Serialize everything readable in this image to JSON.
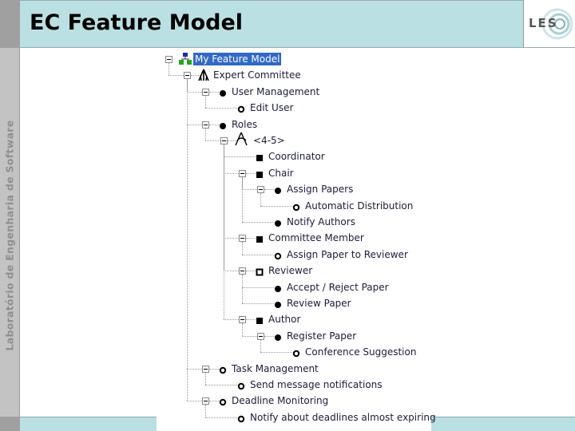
{
  "slide": {
    "title": "EC Feature Model",
    "sidebar_text": "Laboratório de Engenharia de Software",
    "logo_text": "LES",
    "colors": {
      "header": "#bbe0e3",
      "sidebar": "#c3c3c3",
      "selection": "#3169c6"
    }
  },
  "tree": {
    "nodes": [
      {
        "level": 0,
        "label": "My Feature Model",
        "icon": "feature-model-icon",
        "expanded": true,
        "selected": true
      },
      {
        "level": 1,
        "label": "Expert Committee",
        "icon": "root-feature-icon",
        "expanded": true
      },
      {
        "level": 2,
        "label": "User Management",
        "icon": "mandatory-feature-icon",
        "expanded": true
      },
      {
        "level": 3,
        "label": "Edit User",
        "icon": "optional-feature-icon"
      },
      {
        "level": 2,
        "label": "Roles",
        "icon": "mandatory-feature-icon",
        "expanded": true
      },
      {
        "level": 3,
        "label": "<4-5>",
        "icon": "feature-group-icon",
        "expanded": true
      },
      {
        "level": 4,
        "label": "Coordinator",
        "icon": "grouped-feature-icon"
      },
      {
        "level": 4,
        "label": "Chair",
        "icon": "grouped-feature-icon",
        "expanded": true
      },
      {
        "level": 5,
        "label": "Assign Papers",
        "icon": "mandatory-feature-icon",
        "expanded": true
      },
      {
        "level": 6,
        "label": "Automatic Distribution",
        "icon": "optional-feature-icon"
      },
      {
        "level": 5,
        "label": "Notify Authors",
        "icon": "mandatory-feature-icon"
      },
      {
        "level": 4,
        "label": "Committee Member",
        "icon": "grouped-feature-icon",
        "expanded": true
      },
      {
        "level": 5,
        "label": "Assign Paper to Reviewer",
        "icon": "optional-feature-icon"
      },
      {
        "level": 4,
        "label": "Reviewer",
        "icon": "grouped-feature-hollow-icon",
        "expanded": true
      },
      {
        "level": 5,
        "label": "Accept / Reject Paper",
        "icon": "mandatory-feature-icon"
      },
      {
        "level": 5,
        "label": "Review Paper",
        "icon": "mandatory-feature-icon"
      },
      {
        "level": 4,
        "label": "Author",
        "icon": "grouped-feature-icon",
        "expanded": true
      },
      {
        "level": 5,
        "label": "Register Paper",
        "icon": "mandatory-feature-icon",
        "expanded": true
      },
      {
        "level": 6,
        "label": "Conference Suggestion",
        "icon": "optional-feature-icon"
      },
      {
        "level": 2,
        "label": "Task Management",
        "icon": "optional-feature-icon",
        "expanded": true
      },
      {
        "level": 3,
        "label": "Send message notifications",
        "icon": "optional-feature-icon"
      },
      {
        "level": 2,
        "label": "Deadline Monitoring",
        "icon": "optional-feature-icon",
        "expanded": true
      },
      {
        "level": 3,
        "label": "Notify about deadlines almost expiring",
        "icon": "optional-feature-icon"
      }
    ]
  }
}
